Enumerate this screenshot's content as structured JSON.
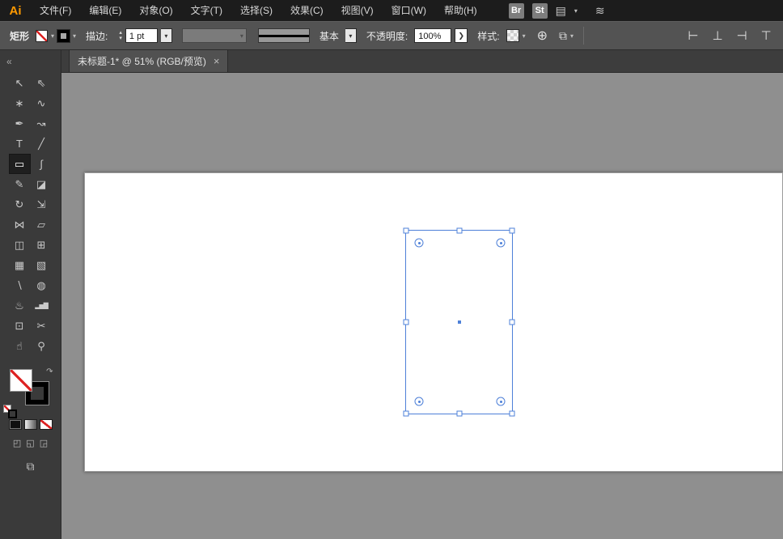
{
  "menubar": {
    "logo": "Ai",
    "items": [
      "文件(F)",
      "编辑(E)",
      "对象(O)",
      "文字(T)",
      "选择(S)",
      "效果(C)",
      "视图(V)",
      "窗口(W)",
      "帮助(H)"
    ],
    "bridge_badge": "Br",
    "stock_badge": "St"
  },
  "controlbar": {
    "tool_label": "矩形",
    "stroke_label": "描边:",
    "stroke_value": "1 pt",
    "brush_label": "基本",
    "opacity_label": "不透明度:",
    "opacity_value": "100%",
    "style_label": "样式:"
  },
  "tabbar": {
    "collapse": "«",
    "tab_label": "未标题-1* @ 51% (RGB/预览)",
    "close": "×"
  },
  "toolbar": {
    "tools": [
      {
        "name": "selection-tool",
        "glyph": "↖",
        "selected": false
      },
      {
        "name": "direct-selection-tool",
        "glyph": "⇖",
        "selected": false
      },
      {
        "name": "magic-wand-tool",
        "glyph": "∗",
        "selected": false
      },
      {
        "name": "lasso-tool",
        "glyph": "∿",
        "selected": false
      },
      {
        "name": "pen-tool",
        "glyph": "✒",
        "selected": false
      },
      {
        "name": "curvature-tool",
        "glyph": "↝",
        "selected": false
      },
      {
        "name": "type-tool",
        "glyph": "T",
        "selected": false
      },
      {
        "name": "line-segment-tool",
        "glyph": "╱",
        "selected": false
      },
      {
        "name": "rectangle-tool",
        "glyph": "▭",
        "selected": true
      },
      {
        "name": "paintbrush-tool",
        "glyph": "∫",
        "selected": false
      },
      {
        "name": "pencil-tool",
        "glyph": "✎",
        "selected": false
      },
      {
        "name": "eraser-tool",
        "glyph": "◪",
        "selected": false
      },
      {
        "name": "rotate-tool",
        "glyph": "↻",
        "selected": false
      },
      {
        "name": "scale-tool",
        "glyph": "⇲",
        "selected": false
      },
      {
        "name": "width-tool",
        "glyph": "⋈",
        "selected": false
      },
      {
        "name": "free-transform-tool",
        "glyph": "▱",
        "selected": false
      },
      {
        "name": "shape-builder-tool",
        "glyph": "◫",
        "selected": false
      },
      {
        "name": "perspective-grid-tool",
        "glyph": "⊞",
        "selected": false
      },
      {
        "name": "mesh-tool",
        "glyph": "▦",
        "selected": false
      },
      {
        "name": "gradient-tool",
        "glyph": "▧",
        "selected": false
      },
      {
        "name": "eyedropper-tool",
        "glyph": "∖",
        "selected": false
      },
      {
        "name": "blend-tool",
        "glyph": "◍",
        "selected": false
      },
      {
        "name": "symbol-sprayer-tool",
        "glyph": "♨",
        "selected": false
      },
      {
        "name": "column-graph-tool",
        "glyph": "▂▅▇",
        "selected": false,
        "small": true
      },
      {
        "name": "artboard-tool",
        "glyph": "⊡",
        "selected": false
      },
      {
        "name": "slice-tool",
        "glyph": "✂",
        "selected": false
      },
      {
        "name": "hand-tool",
        "glyph": "☝",
        "selected": false
      },
      {
        "name": "zoom-tool",
        "glyph": "⚲",
        "selected": false
      }
    ]
  },
  "icons": {
    "caret": "▾",
    "stepper_up": "▴",
    "stepper_down": "▾",
    "chevron_right": "❯",
    "workspace": "▤",
    "scribble": "≋",
    "globe": "⊕",
    "arrange": "⧉",
    "swap": "↷",
    "screen_mode": "⧉",
    "draw_normal": "◰",
    "draw_behind": "◱",
    "draw_inside": "◲",
    "align": [
      "⊢",
      "⊥",
      "⊣",
      "⊤"
    ]
  },
  "colors": {
    "selection_blue": "#4e80d8",
    "logo_orange": "#ff9a00",
    "none_slash_red": "#dd2222",
    "controlbar_gray": "#535353",
    "canvas_gray": "#8f8f8f"
  }
}
